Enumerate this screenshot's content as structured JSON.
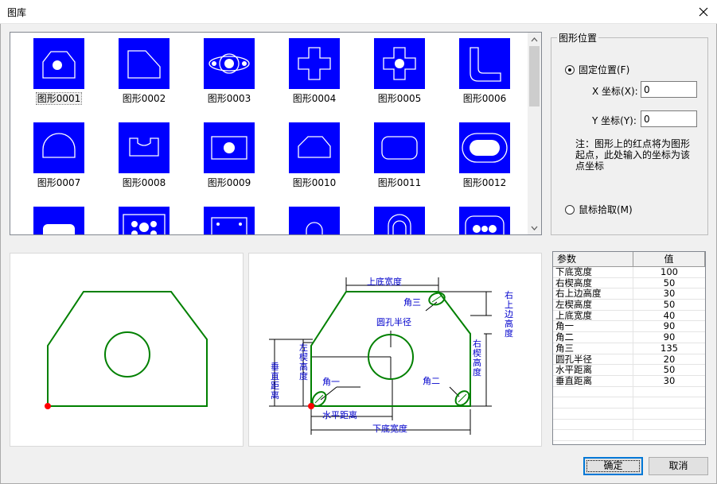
{
  "window": {
    "title": "图库"
  },
  "gallery": {
    "items": [
      {
        "label": "图形0001",
        "shape": "chamfer-circle",
        "selected": true
      },
      {
        "label": "图形0002",
        "shape": "right-chamfer"
      },
      {
        "label": "图形0003",
        "shape": "flange"
      },
      {
        "label": "图形0004",
        "shape": "cross"
      },
      {
        "label": "图形0005",
        "shape": "cross-hole"
      },
      {
        "label": "图形0006",
        "shape": "l-fillet"
      },
      {
        "label": "图形0007",
        "shape": "dome"
      },
      {
        "label": "图形0008",
        "shape": "notch"
      },
      {
        "label": "图形0009",
        "shape": "rect-hole"
      },
      {
        "label": "图形0010",
        "shape": "chamfer-plate"
      },
      {
        "label": "图形0011",
        "shape": "rounded-rect"
      },
      {
        "label": "图形0012",
        "shape": "slot"
      },
      {
        "label": "",
        "shape": "partial-1"
      },
      {
        "label": "",
        "shape": "partial-2"
      },
      {
        "label": "",
        "shape": "partial-3"
      },
      {
        "label": "",
        "shape": "partial-4"
      },
      {
        "label": "",
        "shape": "partial-5"
      },
      {
        "label": "",
        "shape": "partial-6"
      }
    ]
  },
  "position_group": {
    "title": "图形位置",
    "fixed_label": "固定位置(F)",
    "x_label": "X 坐标(X):",
    "x_value": "0",
    "y_label": "Y 坐标(Y):",
    "y_value": "0",
    "note": "注：图形上的红点将为图形起点，此处输入的坐标为该点坐标",
    "mouse_label": "鼠标拾取(M)",
    "selected": "fixed"
  },
  "diagram": {
    "top_width": "上底宽度",
    "angle3": "角三",
    "right_top_edge": [
      "右",
      "上",
      "边",
      "高",
      "度"
    ],
    "hole_radius": "圆孔半径",
    "left_bevel": [
      "左",
      "楔",
      "高",
      "度"
    ],
    "vertical_dist": [
      "垂",
      "直",
      "距",
      "离"
    ],
    "right_bevel": [
      "右",
      "楔",
      "高",
      "度"
    ],
    "angle1": "角一",
    "angle2": "角二",
    "horizontal_dist": "水平距离",
    "bottom_width": "下底宽度"
  },
  "params": {
    "col_param": "参数",
    "col_value": "值",
    "rows": [
      {
        "name": "下底宽度",
        "value": "100"
      },
      {
        "name": "右楔高度",
        "value": "50"
      },
      {
        "name": "右上边高度",
        "value": "30"
      },
      {
        "name": "左楔高度",
        "value": "50"
      },
      {
        "name": "上底宽度",
        "value": "40"
      },
      {
        "name": "角一",
        "value": "90"
      },
      {
        "name": "角二",
        "value": "90"
      },
      {
        "name": "角三",
        "value": "135"
      },
      {
        "name": "圆孔半径",
        "value": "20"
      },
      {
        "name": "水平距离",
        "value": "50"
      },
      {
        "name": "垂直距离",
        "value": "30"
      },
      {
        "name": "",
        "value": ""
      },
      {
        "name": "",
        "value": ""
      },
      {
        "name": "",
        "value": ""
      },
      {
        "name": "",
        "value": ""
      },
      {
        "name": "",
        "value": ""
      }
    ]
  },
  "buttons": {
    "ok": "确定",
    "cancel": "取消"
  },
  "colors": {
    "thumb_bg": "#0000ff",
    "shape_line": "#008000",
    "dimension": "#0000cc",
    "origin_dot": "#ff0000"
  }
}
